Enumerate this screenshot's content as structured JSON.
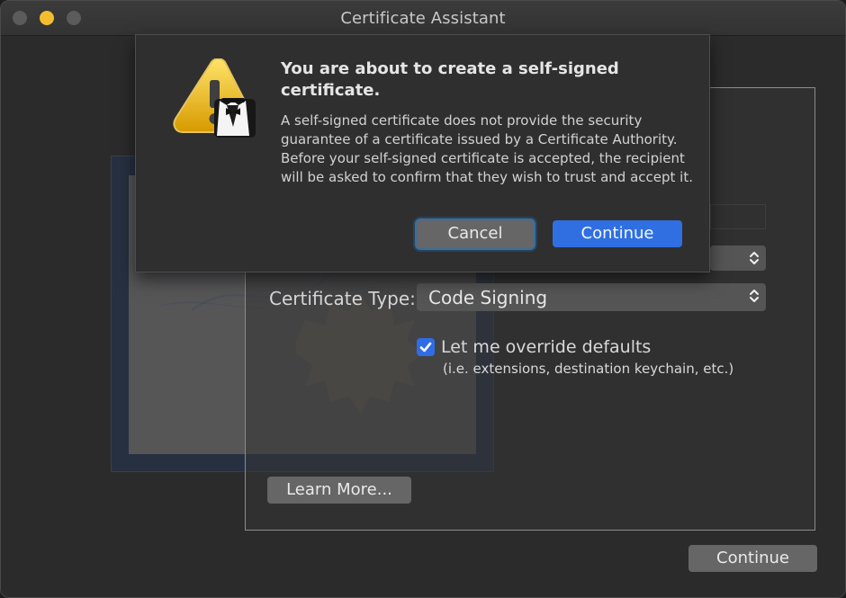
{
  "window": {
    "title": "Certificate Assistant"
  },
  "dialog": {
    "title": "You are about to create a self-signed certificate.",
    "body": "A self-signed certificate does not provide the security guarantee of a certificate issued by a Certificate Authority. Before your self-signed certificate is accepted, the recipient will be asked to confirm that they wish to trust and accept it.",
    "cancel_label": "Cancel",
    "continue_label": "Continue"
  },
  "form": {
    "certificate_type_label": "Certificate Type:",
    "certificate_type_value": "Code Signing",
    "override_defaults_label": "Let me override defaults",
    "override_defaults_help": "(i.e. extensions, destination keychain, etc.)",
    "override_defaults_checked": true
  },
  "buttons": {
    "learn_more_label": "Learn More...",
    "continue_label": "Continue"
  },
  "colors": {
    "accent": "#2f6fe2",
    "warning": "#f2be2f",
    "background": "#2b2b2b"
  }
}
